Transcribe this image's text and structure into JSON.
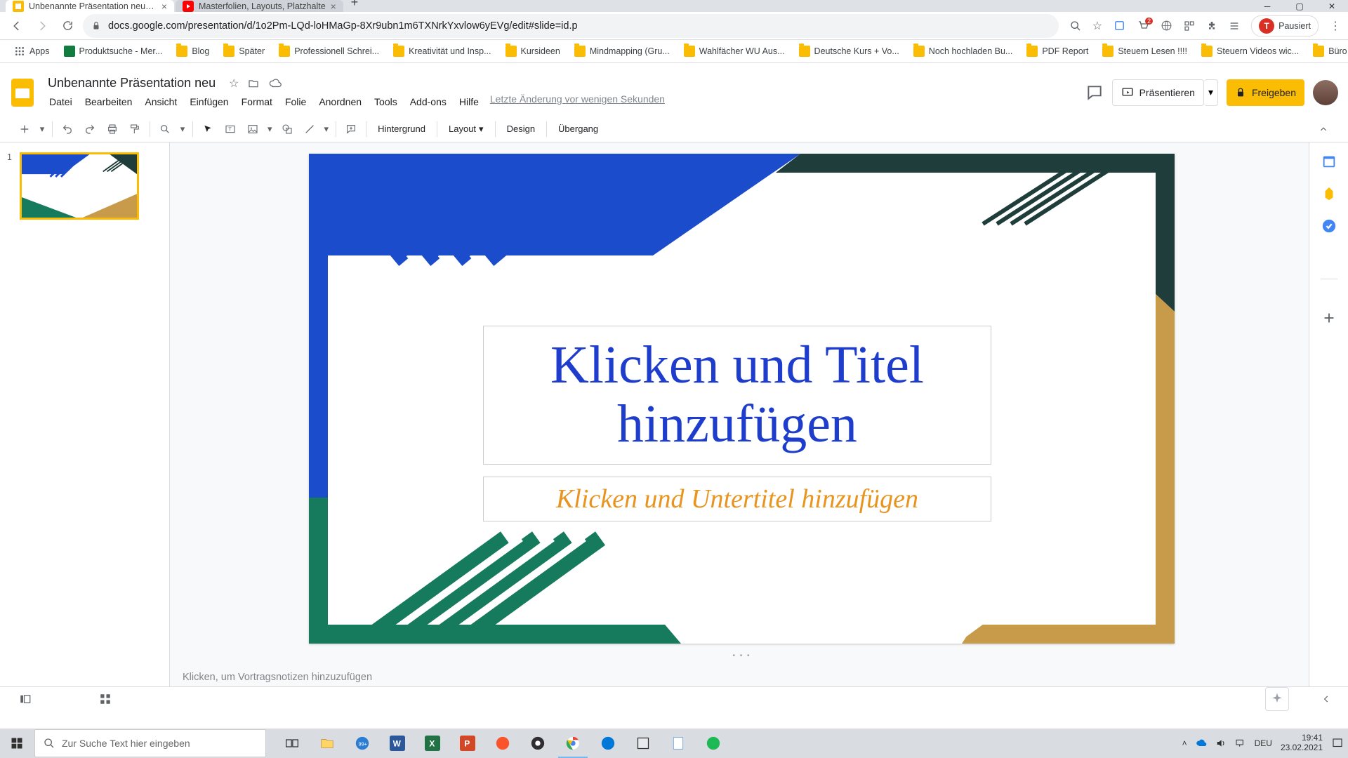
{
  "browser": {
    "tabs": [
      {
        "title": "Unbenannte Präsentation neu - C",
        "active": true,
        "favicon": "slides"
      },
      {
        "title": "Masterfolien, Layouts, Platzhalte",
        "active": false,
        "favicon": "youtube"
      }
    ],
    "url": "docs.google.com/presentation/d/1o2Pm-LQd-loHMaGp-8Xr9ubn1m6TXNrkYxvlow6yEVg/edit#slide=id.p",
    "pause_label": "Pausiert",
    "bookmarks": [
      "Apps",
      "Produktsuche - Mer...",
      "Blog",
      "Später",
      "Professionell Schrei...",
      "Kreativität und Insp...",
      "Kursideen",
      "Mindmapping (Gru...",
      "Wahlfächer WU Aus...",
      "Deutsche Kurs + Vo...",
      "Noch hochladen Bu...",
      "PDF Report",
      "Steuern Lesen !!!!",
      "Steuern Videos wic...",
      "Büro"
    ]
  },
  "app": {
    "doc_title": "Unbenannte Präsentation neu",
    "menus": [
      "Datei",
      "Bearbeiten",
      "Ansicht",
      "Einfügen",
      "Format",
      "Folie",
      "Anordnen",
      "Tools",
      "Add-ons",
      "Hilfe"
    ],
    "last_edit": "Letzte Änderung vor wenigen Sekunden",
    "present_label": "Präsentieren",
    "share_label": "Freigeben"
  },
  "toolbar": {
    "background": "Hintergrund",
    "layout": "Layout",
    "design": "Design",
    "transition": "Übergang"
  },
  "filmstrip": {
    "slide_num": "1"
  },
  "slide": {
    "title": "Klicken und Titel hinzufügen",
    "subtitle": "Klicken und Untertitel hinzufügen"
  },
  "speaker_notes_placeholder": "Klicken, um Vortragsnotizen hinzuzufügen",
  "taskbar": {
    "search_placeholder": "Zur Suche Text hier eingeben",
    "lang": "DEU",
    "time": "19:41",
    "date": "23.02.2021"
  }
}
